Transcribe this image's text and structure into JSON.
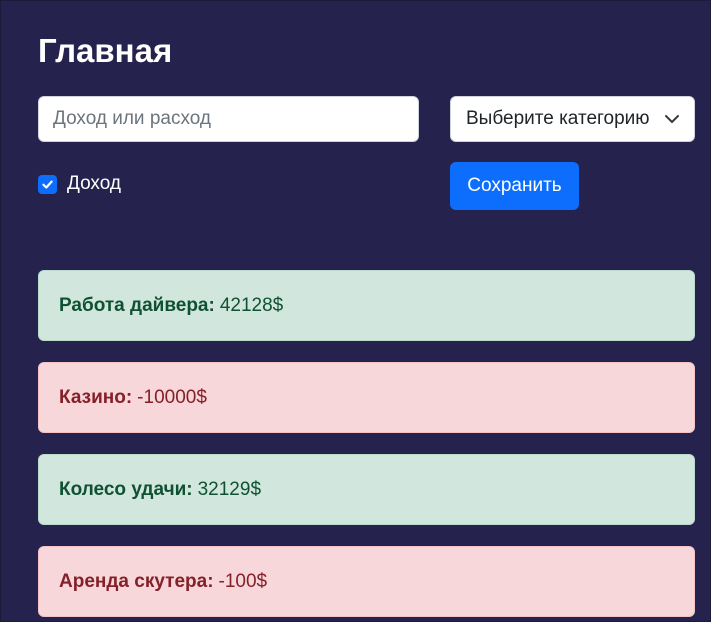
{
  "header": {
    "title": "Главная"
  },
  "form": {
    "amount_placeholder": "Доход или расход",
    "category_select": {
      "selected": "Выберите категорию"
    },
    "income_checkbox": {
      "label": "Доход",
      "checked": true
    },
    "save_label": "Сохранить"
  },
  "colors": {
    "background": "#25234d",
    "accent": "#0d6efd",
    "income_bg": "#d1e7dd",
    "income_text": "#0f5132",
    "expense_bg": "#f8d7da",
    "expense_text": "#842029"
  },
  "entries": [
    {
      "name": "Работа дайвера",
      "amount": "42128$",
      "type": "income"
    },
    {
      "name": "Казино",
      "amount": "-10000$",
      "type": "expense"
    },
    {
      "name": "Колесо удачи",
      "amount": "32129$",
      "type": "income"
    },
    {
      "name": "Аренда скутера",
      "amount": "-100$",
      "type": "expense"
    }
  ]
}
